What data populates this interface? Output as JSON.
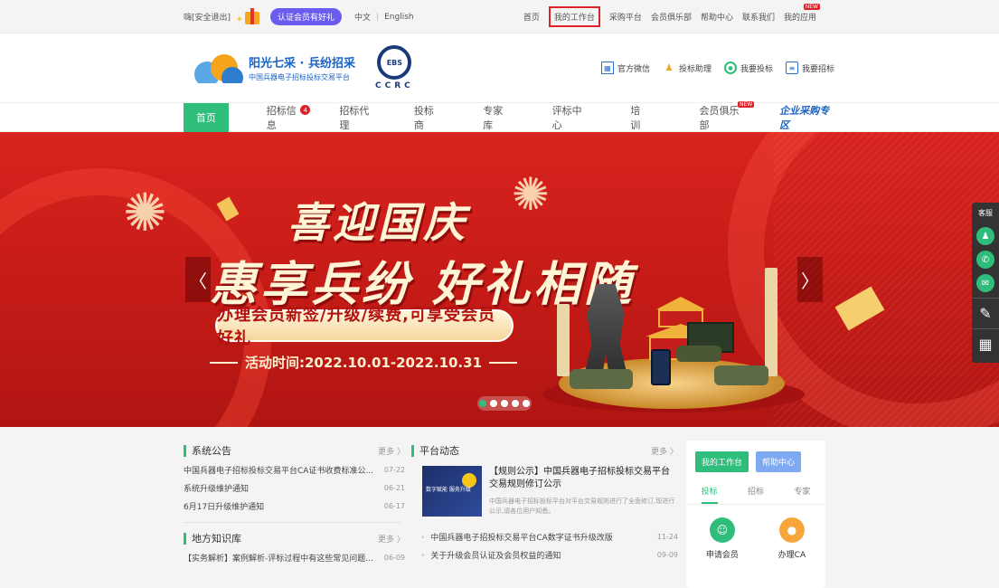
{
  "topbar": {
    "greeting": "嗨[安全退出]",
    "cert_button": "认证会员有好礼",
    "lang_cn": "中文",
    "lang_en": "English",
    "links": [
      "首页",
      "我的工作台",
      "采购平台",
      "会员俱乐部",
      "帮助中心",
      "联系我们",
      "我的应用"
    ],
    "new_badge": "NEW"
  },
  "header": {
    "logo_title": "阳光七采 · 兵纷招采",
    "logo_subtitle": "中国兵器电子招标投标交易平台",
    "ebs_text": "EBS",
    "ccrc_text": "CCRC",
    "links": [
      {
        "icon": "qr-icon",
        "label": "官方微信"
      },
      {
        "icon": "person-icon",
        "label": "投标助理"
      },
      {
        "icon": "bid-icon",
        "label": "我要投标"
      },
      {
        "icon": "document-icon",
        "label": "我要招标"
      }
    ]
  },
  "nav": {
    "items": [
      "首页",
      "招标信息",
      "招标代理",
      "投标商",
      "专家库",
      "评标中心",
      "培训",
      "会员俱乐部",
      "企业采购专区"
    ],
    "badge_count": "4",
    "new_badge": "NEW",
    "active_index": 0
  },
  "banner": {
    "title_line1": "喜迎国庆",
    "title_line2": "惠享兵纷 好礼相随",
    "pill_text": "办理会员新签/升级/续费,可享受会员好礼",
    "date_text": "活动时间:2022.10.01-2022.10.31",
    "prev_arrow": "〈",
    "next_arrow": "〉",
    "slide_count": 5,
    "active_slide": 0
  },
  "float": {
    "title": "客服",
    "icons": [
      "person-icon",
      "phone-icon",
      "mail-icon",
      "edit-icon",
      "qr-icon"
    ]
  },
  "announcements": {
    "title": "系统公告",
    "more": "更多 〉",
    "items": [
      {
        "text": "中国兵器电子招标投标交易平台CA证书收费标准公...",
        "date": "07-22"
      },
      {
        "text": "系统升级维护通知",
        "date": "06-21"
      },
      {
        "text": "6月17日升级维护通知",
        "date": "06-17"
      }
    ]
  },
  "knowledge": {
    "title": "地方知识库",
    "more": "更多 〉",
    "items": [
      {
        "text": "【实务解析】案例解析-评标过程中有这些常见问题...",
        "date": "06-09"
      }
    ]
  },
  "platform_news": {
    "title": "平台动态",
    "more": "更多 〉",
    "feature_title": "【规则公示】中国兵器电子招标投标交易平台交易规则修订公示",
    "feature_desc": "中国兵器电子招标投标平台对平台交易规则进行了全面修订,现进行公示,请各位用户知悉。",
    "feature_image_text": "数字赋能 服务升级",
    "items": [
      {
        "text": "中国兵器电子招投标交易平台CA数字证书升级改版",
        "date": "11-24"
      },
      {
        "text": "关于升级会员认证及会员权益的通知",
        "date": "09-09"
      }
    ]
  },
  "workspace": {
    "btn_workbench": "我的工作台",
    "btn_help": "帮助中心",
    "tabs": [
      "投标",
      "招标",
      "专家"
    ],
    "active_tab": 0,
    "icons": [
      {
        "icon": "member-icon",
        "label": "申请会员"
      },
      {
        "icon": "ca-icon",
        "label": "办理CA"
      }
    ]
  },
  "colors": {
    "primary_green": "#2ebd7a",
    "brand_blue": "#1a62c4",
    "banner_red": "#d8231e",
    "highlight_red": "#e0202a"
  }
}
